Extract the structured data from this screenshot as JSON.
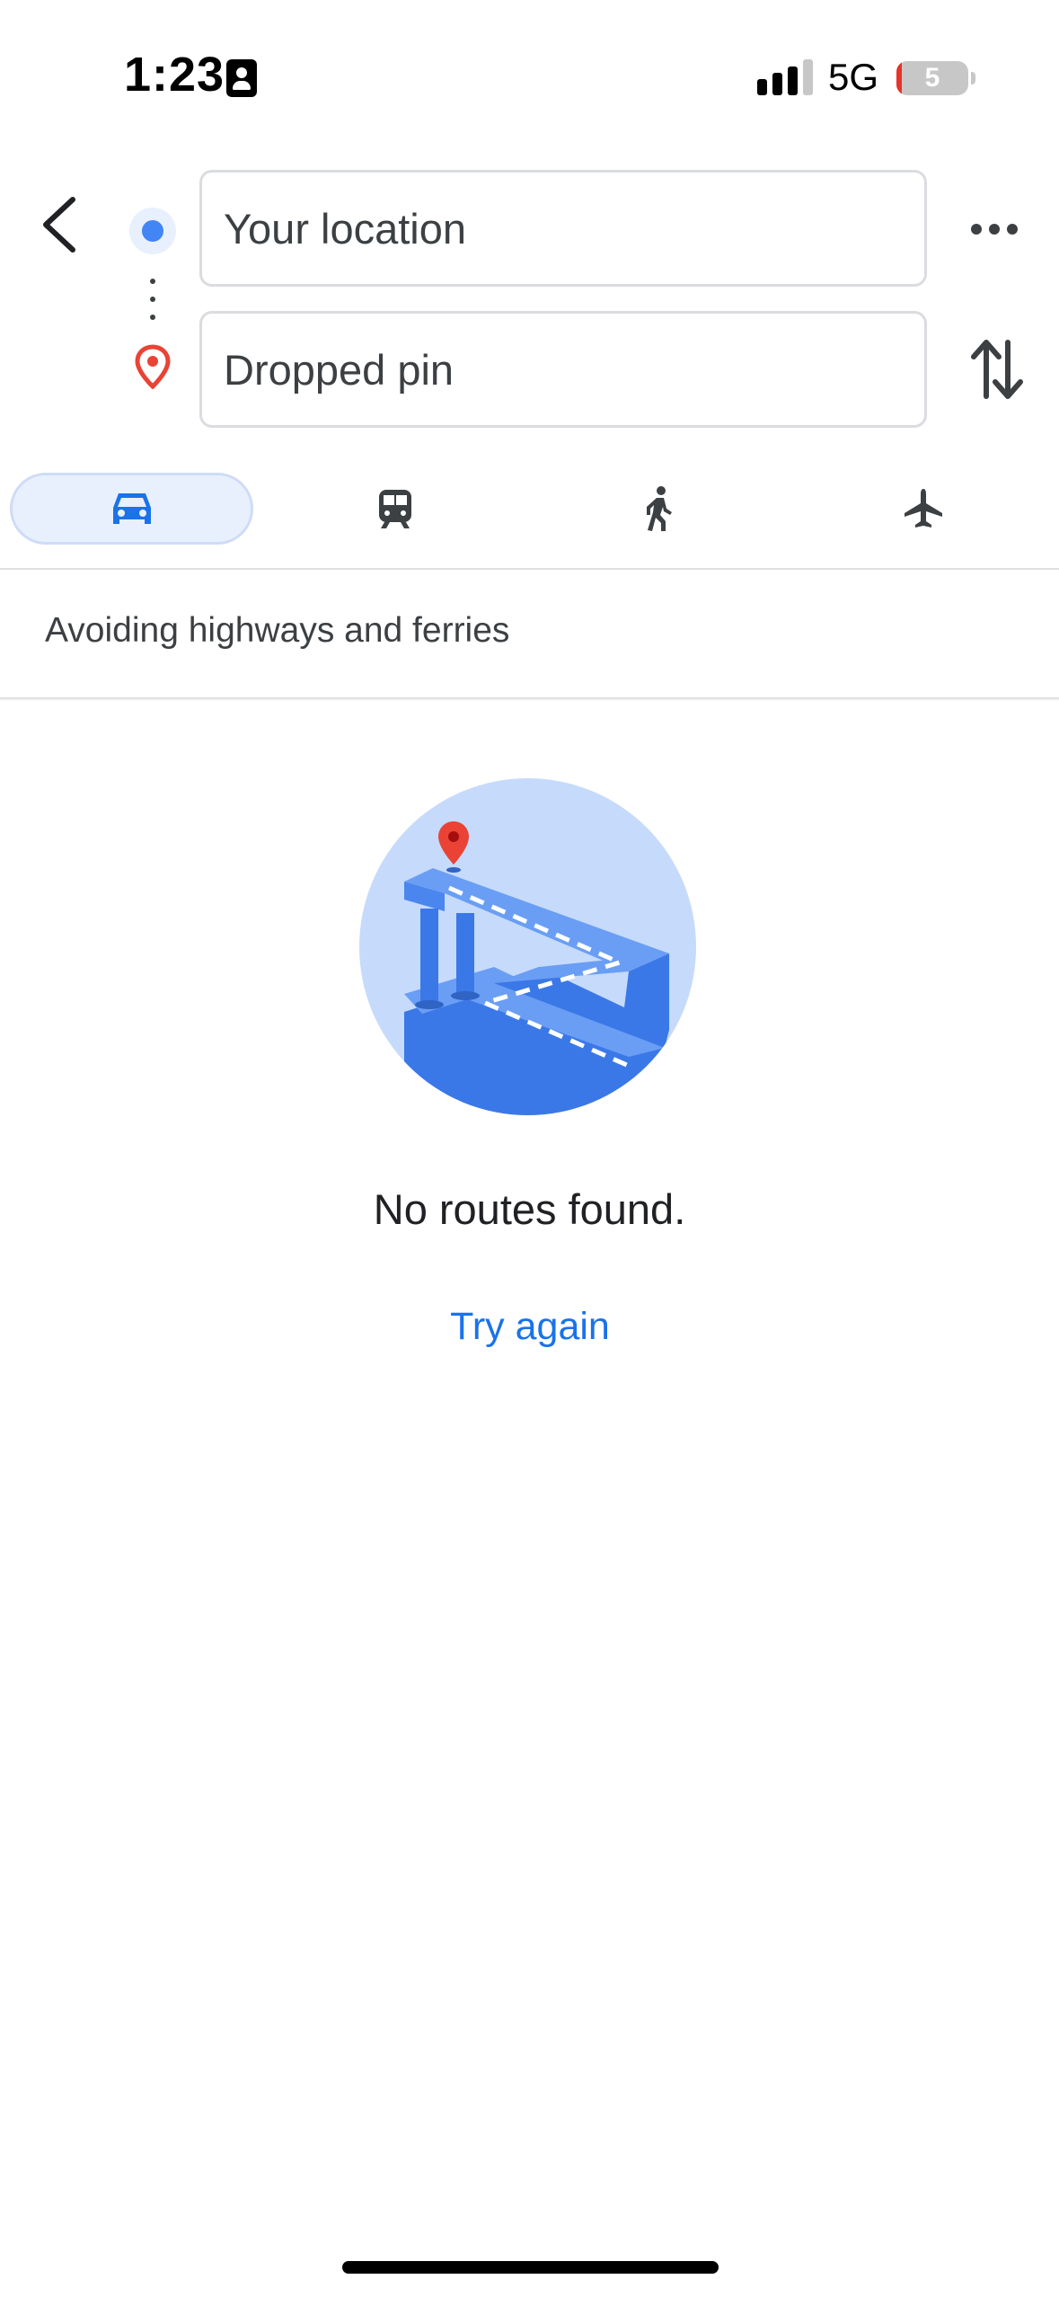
{
  "status_bar": {
    "time": "1:23",
    "network": "5G",
    "battery": "5"
  },
  "directions": {
    "origin": {
      "value": "Your location",
      "dot_color": "#4285f4"
    },
    "destination": {
      "value": "Dropped pin",
      "pin_color": "#ea4335"
    }
  },
  "travel_modes": [
    {
      "icon": "car-icon",
      "selected": true
    },
    {
      "icon": "train-icon",
      "selected": false
    },
    {
      "icon": "walk-icon",
      "selected": false
    },
    {
      "icon": "flight-icon",
      "selected": false
    }
  ],
  "route_options_notice": "Avoiding highways and ferries",
  "empty_state": {
    "message": "No routes found.",
    "action_label": "Try again"
  },
  "colors": {
    "accent": "#1a73e8",
    "selected_mode_bg": "#e8f0fe"
  }
}
